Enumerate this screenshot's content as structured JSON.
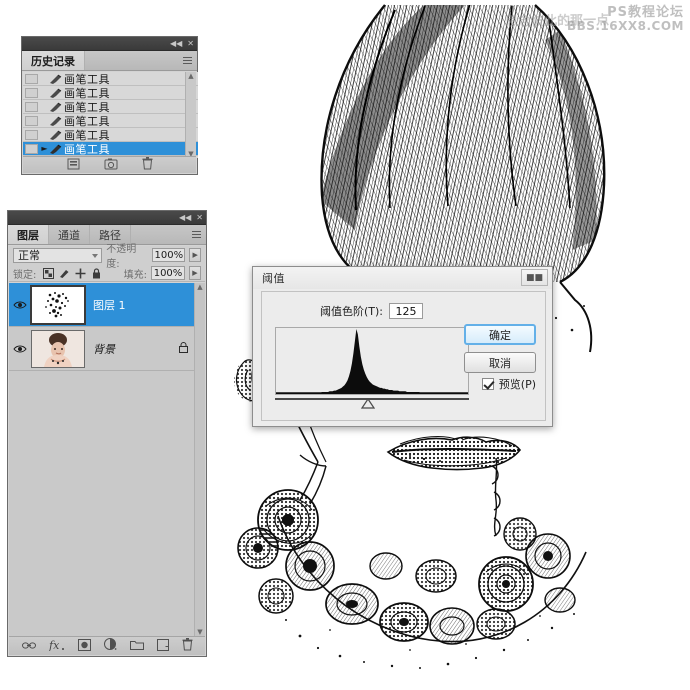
{
  "app": {
    "canvas_background": "#ffffff",
    "panel_background": "#d3d3d3",
    "selection_color": "#2e90d8"
  },
  "watermark": {
    "faint_text": "思念彼此的那一点",
    "line1": "PS教程论坛",
    "line2": "BBS.16XX8.COM"
  },
  "history_panel": {
    "tab_label": "历史记录",
    "collapse_icon": "collapse-icon",
    "close_icon": "close-icon",
    "menu_icon": "panel-menu-icon",
    "rows": [
      {
        "label": "画笔工具",
        "icon": "brush-icon",
        "selected": false
      },
      {
        "label": "画笔工具",
        "icon": "brush-icon",
        "selected": false
      },
      {
        "label": "画笔工具",
        "icon": "brush-icon",
        "selected": false
      },
      {
        "label": "画笔工具",
        "icon": "brush-icon",
        "selected": false
      },
      {
        "label": "画笔工具",
        "icon": "brush-icon",
        "selected": false
      },
      {
        "label": "画笔工具",
        "icon": "brush-icon",
        "selected": true
      }
    ],
    "footer_icons": [
      "snapshot-icon",
      "new-document-icon",
      "delete-icon"
    ]
  },
  "layers_panel": {
    "collapse_icon": "collapse-icon",
    "close_icon": "close-icon",
    "menu_icon": "panel-menu-icon",
    "tabs": [
      {
        "label": "图层",
        "active": true
      },
      {
        "label": "通道",
        "active": false
      },
      {
        "label": "路径",
        "active": false
      }
    ],
    "blend_mode": "正常",
    "opacity_label": "不透明度:",
    "opacity_value": "100%",
    "lock_label": "锁定:",
    "lock_icons": [
      "lock-transparency-icon",
      "lock-image-icon",
      "lock-position-icon",
      "lock-all-icon"
    ],
    "fill_label": "填充:",
    "fill_value": "100%",
    "layers": [
      {
        "name": "图层 1",
        "selected": true,
        "visible": true,
        "locked": false,
        "thumbnail": "threshold-speckles-thumb",
        "eye_icon": "eye-icon"
      },
      {
        "name": "背景",
        "selected": false,
        "visible": true,
        "locked": true,
        "thumbnail": "portrait-photo-thumb",
        "eye_icon": "eye-icon",
        "lock_icon": "lock-icon"
      }
    ],
    "footer_icons": [
      "link-layers-icon",
      "layer-style-fx-icon",
      "add-layer-mask-icon",
      "adjustment-layer-icon",
      "new-group-icon",
      "new-layer-icon",
      "delete-layer-icon"
    ]
  },
  "threshold_dialog": {
    "title": "阈值",
    "close_icon": "close-icon",
    "level_label": "阈值色阶(T):",
    "level_value": "125",
    "ok_label": "确定",
    "cancel_label": "取消",
    "preview_label": "预览(P)",
    "preview_checked": true,
    "histogram": {
      "slider_position_percent": 48,
      "bins": [
        1,
        1,
        1,
        1,
        1,
        1,
        1,
        1,
        1,
        1,
        1,
        1,
        1,
        1,
        1,
        1,
        1,
        1,
        1,
        1,
        1,
        1,
        1,
        1,
        2,
        2,
        2,
        2,
        2,
        2,
        2,
        3,
        3,
        3,
        3,
        3,
        4,
        4,
        4,
        5,
        5,
        6,
        7,
        8,
        9,
        11,
        13,
        16,
        20,
        26,
        34,
        45,
        60,
        78,
        96,
        88,
        70,
        55,
        44,
        36,
        30,
        25,
        21,
        18,
        16,
        14,
        13,
        12,
        11,
        10,
        9,
        9,
        8,
        8,
        7,
        7,
        6,
        6,
        6,
        5,
        5,
        5,
        5,
        4,
        4,
        4,
        4,
        4,
        3,
        3,
        3,
        3,
        3,
        3,
        3,
        3,
        3,
        2,
        2,
        2,
        2,
        2,
        2,
        2,
        2,
        2,
        2,
        2,
        2,
        2,
        2,
        2,
        2,
        2,
        2,
        2,
        2,
        2,
        2,
        2,
        2,
        2,
        2,
        2,
        2,
        1,
        1,
        1,
        1,
        1
      ]
    }
  },
  "artwork": {
    "description": "threshold-filtered portrait: hair, lips, necklace",
    "ink_color": "#101010"
  }
}
